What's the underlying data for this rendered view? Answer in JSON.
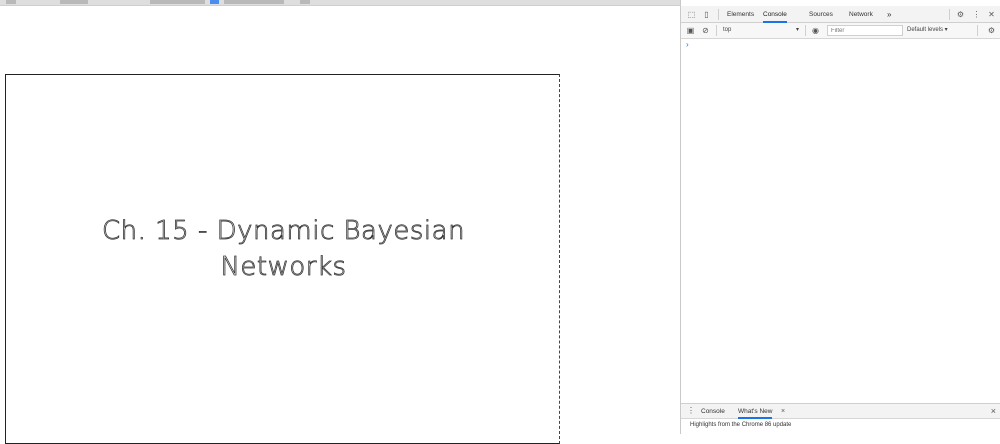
{
  "slide": {
    "title_line1": "Ch. 15 - Dynamic Bayesian",
    "title_line2": "Networks"
  },
  "devtools": {
    "tabs": [
      {
        "label": "Elements"
      },
      {
        "label": "Console"
      },
      {
        "label": "Sources"
      },
      {
        "label": "Network"
      }
    ],
    "more_tabs_glyph": "»",
    "settings_glyph": "⚙",
    "menu_glyph": "⋮",
    "close_glyph": "✕",
    "inspect_glyph": "⬚",
    "device_glyph": "▯",
    "toolbar": {
      "sidebar_glyph": "▣",
      "clear_glyph": "⊘",
      "context": "top",
      "context_caret": "▾",
      "eye_glyph": "◉",
      "filter_placeholder": "Filter",
      "levels": "Default levels ▾",
      "settings_glyph": "⚙"
    },
    "console_prompt": "›",
    "drawer": {
      "menu_glyph": "⋮",
      "tabs": [
        {
          "label": "Console"
        },
        {
          "label": "What's New"
        }
      ],
      "tab_close_glyph": "×",
      "close_glyph": "×",
      "message": "Highlights from the Chrome 86 update"
    }
  },
  "colors": {
    "accent": "#1a73e8",
    "tab_bar_bg": "#f3f3f3"
  }
}
